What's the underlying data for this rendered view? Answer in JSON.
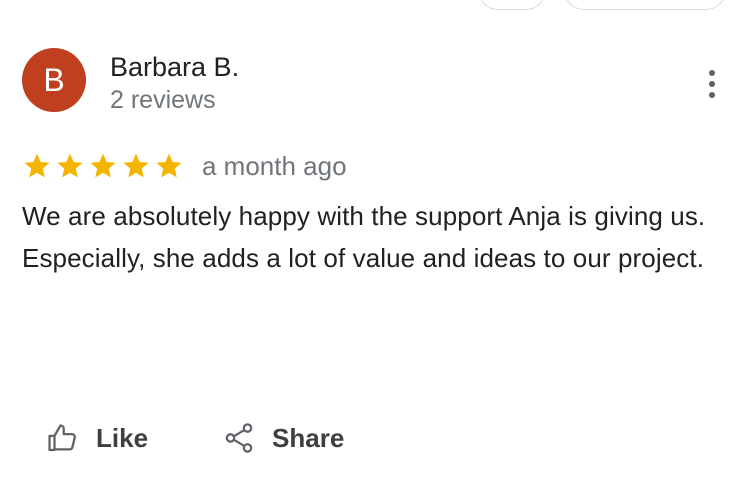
{
  "review": {
    "avatar_letter": "B",
    "avatar_color": "#bf3f1f",
    "author_name": "Barbara B.",
    "author_meta": "2 reviews",
    "rating": 5,
    "rating_max": 5,
    "star_color": "#f4b400",
    "time_ago": "a month ago",
    "text_lines": [
      "We are absolutely happy with the support Anja is giving us.",
      "Especially, she adds a lot of value and ideas to our project."
    ]
  },
  "menu": {
    "icon": "more-vert-icon"
  },
  "actions": {
    "like_label": "Like",
    "like_icon": "thumb-up-icon",
    "share_label": "Share",
    "share_icon": "share-icon"
  }
}
